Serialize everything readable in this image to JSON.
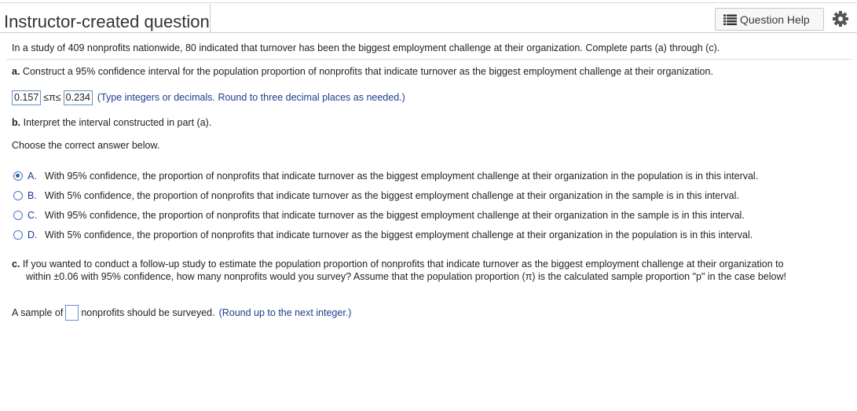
{
  "header": {
    "title": "Instructor-created question",
    "help_button_label": "Question Help",
    "help_icon": "list-icon",
    "settings_icon": "gear-icon"
  },
  "intro": "In a study of 409 nonprofits nationwide, 80 indicated that turnover has been the biggest employment challenge at their organization. Complete parts (a) through (c).",
  "part_a": {
    "label": "a.",
    "text": "Construct a 95% confidence interval for the population proportion of nonprofits that indicate turnover as the biggest employment challenge at their organization.",
    "lower": "0.157",
    "symbol": "≤π≤",
    "upper": "0.234",
    "note": "(Type integers or decimals. Round to three decimal places as needed.)"
  },
  "part_b": {
    "label": "b.",
    "text": "Interpret the interval constructed in part (a).",
    "prompt": "Choose the correct answer below.",
    "options": [
      {
        "letter": "A.",
        "text": "With 95% confidence, the proportion of nonprofits that indicate turnover as the biggest employment challenge at their organization in the population is in this interval.",
        "selected": true
      },
      {
        "letter": "B.",
        "text": "With 5% confidence, the proportion of nonprofits that indicate turnover as the biggest employment challenge at their organization in the sample is in this interval.",
        "selected": false
      },
      {
        "letter": "C.",
        "text": "With 95% confidence, the proportion of nonprofits that indicate turnover as the biggest employment challenge at their organization in the sample is in this interval.",
        "selected": false
      },
      {
        "letter": "D.",
        "text": "With 5% confidence, the proportion of nonprofits that indicate turnover as the biggest employment challenge at their organization in the population is in this interval.",
        "selected": false
      }
    ]
  },
  "part_c": {
    "label": "c.",
    "text_line1": "If you wanted to conduct a follow-up study to estimate the population proportion of nonprofits that indicate turnover as the biggest employment challenge at their organization to",
    "text_line2": "within ±0.06 with 95% confidence, how many nonprofits would you survey? Assume that the population proportion (π) is the calculated sample proportion \"p\" in the case below!",
    "prefix": "A sample of",
    "suffix": "nonprofits should be surveyed.",
    "note": "(Round up to the next integer.)",
    "value": ""
  },
  "colors": {
    "accent": "#1b3d8f",
    "input_border": "#6a8ec7",
    "radio": "#4a76c4"
  }
}
